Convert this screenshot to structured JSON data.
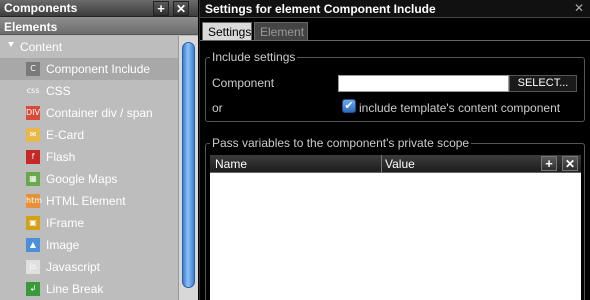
{
  "left_panel": {
    "title": "Components",
    "subtitle": "Elements",
    "group": "Content",
    "items": [
      {
        "label": "Component Include",
        "icon": "component-include-icon",
        "glyph": "C",
        "color": "#7a7a7a"
      },
      {
        "label": "CSS",
        "icon": "css-icon",
        "glyph": "css",
        "color": "#bdbdbd"
      },
      {
        "label": "Container div / span",
        "icon": "div-icon",
        "glyph": "DIV",
        "color": "#d84a3a"
      },
      {
        "label": "E-Card",
        "icon": "ecard-icon",
        "glyph": "✉",
        "color": "#e8b84a"
      },
      {
        "label": "Flash",
        "icon": "flash-icon",
        "glyph": "f",
        "color": "#c62828"
      },
      {
        "label": "Google Maps",
        "icon": "google-maps-icon",
        "glyph": "▦",
        "color": "#6aa84f"
      },
      {
        "label": "HTML Element",
        "icon": "html-element-icon",
        "glyph": "htm",
        "color": "#e69138"
      },
      {
        "label": "IFrame",
        "icon": "iframe-icon",
        "glyph": "▣",
        "color": "#d4a017"
      },
      {
        "label": "Image",
        "icon": "image-icon",
        "glyph": "▲",
        "color": "#4a90d9"
      },
      {
        "label": "Javascript",
        "icon": "javascript-icon",
        "glyph": "js",
        "color": "#e0e0e0"
      },
      {
        "label": "Line Break",
        "icon": "line-break-icon",
        "glyph": "↲",
        "color": "#3a9a3a"
      }
    ]
  },
  "right_panel": {
    "title": "Settings for element Component Include",
    "tabs": [
      "Settings",
      "Element"
    ],
    "include_settings": {
      "legend": "Include settings",
      "component_label": "Component",
      "component_value": "",
      "select_button": "SELECT...",
      "or_label": "or",
      "checkbox_label": "include template's content component",
      "checkbox_checked": true
    },
    "pass_variables": {
      "legend": "Pass variables to the component's private scope",
      "columns": [
        "Name",
        "Value"
      ]
    }
  }
}
